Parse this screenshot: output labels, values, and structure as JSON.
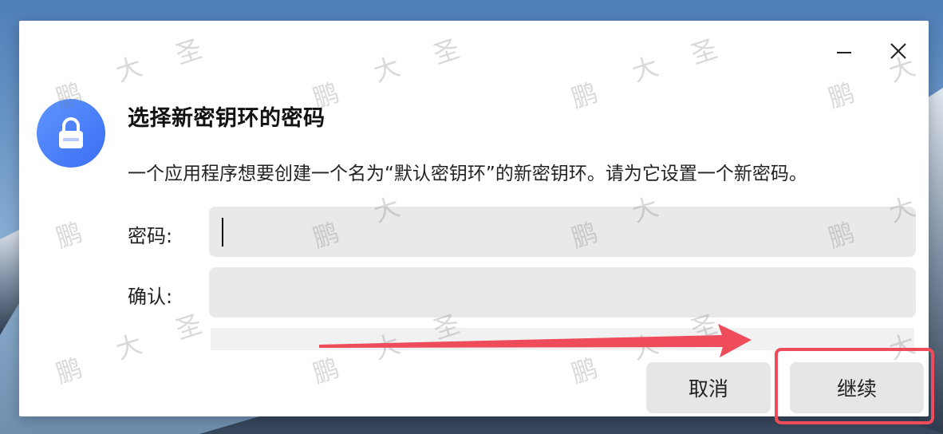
{
  "dialog": {
    "title": "选择新密钥环的密码",
    "description": "一个应用程序想要创建一个名为“默认密钥环”的新密钥环。请为它设置一个新密码。",
    "password_label": "密码:",
    "password_value": "",
    "confirm_label": "确认:",
    "confirm_value": "",
    "cancel_label": "取消",
    "continue_label": "继续"
  },
  "window_controls": {
    "minimize": "minimize-icon",
    "close": "close-icon"
  },
  "icons": {
    "app": "lock-icon"
  },
  "watermark": {
    "chars": [
      "鹏",
      "大",
      "圣"
    ]
  },
  "colors": {
    "accent": "#3a6ef3",
    "annotation": "#ee4b5b",
    "field_bg": "#e9e9e9",
    "button_bg": "#e6e6e6"
  }
}
